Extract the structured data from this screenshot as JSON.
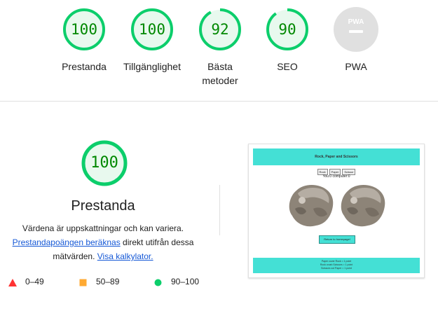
{
  "summary_scores": [
    {
      "id": "performance",
      "score": "100",
      "label": "Prestanda",
      "percent": 100,
      "color": "#0cce6b"
    },
    {
      "id": "accessibility",
      "score": "100",
      "label": "Tillgänglighet",
      "percent": 100,
      "color": "#0cce6b"
    },
    {
      "id": "best-practices",
      "score": "92",
      "label_line1": "Bästa",
      "label_line2": "metoder",
      "percent": 92,
      "color": "#0cce6b"
    },
    {
      "id": "seo",
      "score": "90",
      "label": "SEO",
      "percent": 90,
      "color": "#0cce6b"
    },
    {
      "id": "pwa",
      "label": "PWA",
      "badge_text": "PWA"
    }
  ],
  "detail": {
    "score": "100",
    "percent": 100,
    "title": "Prestanda",
    "desc_line1": "Värdena är uppskattningar och kan variera.",
    "desc_link": "Prestandapoängen beräknas",
    "desc_mid": " direkt utifrån dessa",
    "desc_line3_pre": "mätvärden. ",
    "desc_link2": "Visa kalkylator."
  },
  "legend": [
    {
      "range": "0–49",
      "shape": "triangle",
      "color": "#ff3333"
    },
    {
      "range": "50–89",
      "shape": "square",
      "color": "#ffaa33"
    },
    {
      "range": "90–100",
      "shape": "circle",
      "color": "#0cce6b"
    }
  ],
  "screenshot": {
    "header_title": "Rock, Paper and Scissors",
    "buttons": [
      "Rock",
      "Paper",
      "Scissor"
    ],
    "score_line": "You:0 computer:0",
    "home_button": "Return to homepage!",
    "footer_lines": [
      "Paper cover Rock = 1 point",
      "Rock crush Scissors = 1 point",
      "Scissors cut Paper = 1 point"
    ]
  }
}
